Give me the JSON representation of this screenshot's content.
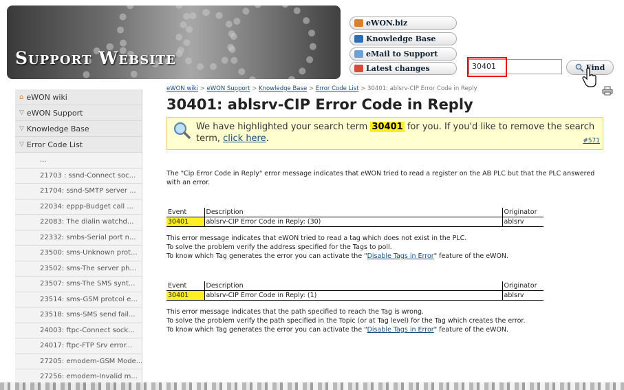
{
  "header": {
    "banner_title": "Support Website",
    "links": [
      {
        "label": "eWON.biz",
        "icon": "home-icon",
        "color": "#d9822b"
      },
      {
        "label": "Knowledge Base",
        "icon": "book-icon",
        "color": "#2d6fb7"
      },
      {
        "label": "eMail to Support",
        "icon": "mail-icon",
        "color": "#6ea0d8"
      },
      {
        "label": "Latest changes",
        "icon": "calendar-icon",
        "color": "#d84a3a"
      }
    ],
    "search_value": "30401",
    "find_label": "Find"
  },
  "sidebar": {
    "top_items": [
      {
        "label": "eWON wiki",
        "icon": "home-icon"
      },
      {
        "label": "eWON Support",
        "icon": "expand-icon"
      },
      {
        "label": "Knowledge Base",
        "icon": "expand-icon"
      },
      {
        "label": "Error Code List",
        "icon": "expand-icon"
      }
    ],
    "sub_items": [
      "...",
      "21703 : ssnd-Connect soc...",
      "21704: ssnd-SMTP server ...",
      "22034: eppp-Budget call ...",
      "22083: The dialin watchd...",
      "22332: smbs-Serial port n...",
      "23500: sms-Unknown prot...",
      "23502: sms-The server ph...",
      "23507: sms-The SMS synt...",
      "23514: sms-GSM protcol e...",
      "23518: sms-SMS send fail...",
      "24003: ftpc-Connect sock...",
      "24017: ftpc-FTP Srv error...",
      "27205: emodem-GSM Mode...",
      "27256: emodem-Invalid m..."
    ]
  },
  "breadcrumb": {
    "items": [
      "eWON wiki",
      "eWON Support",
      "Knowledge Base",
      "Error Code List"
    ],
    "sep": " > ",
    "current": "30401: ablsrv-CIP Error Code in Reply"
  },
  "page_title": "30401: ablsrv-CIP Error Code in Reply",
  "notice": {
    "before": "We have highlighted your search term ",
    "term": "30401",
    "after": " for you. If you'd like to remove the search term, ",
    "link": "click here",
    "end": ".",
    "ref": "#571"
  },
  "intro": "The \"Cip Error Code in Reply\" error message indicates that eWON tried to read a register on the AB PLC but that the PLC answered with an error.",
  "tables": [
    {
      "headers": [
        "Event",
        "Description",
        "Originator"
      ],
      "row": [
        "30401",
        "ablsrv-CIP Error Code in Reply: (30)",
        "ablsrv"
      ],
      "lines": [
        "This error message indicates that eWON tried to read a tag which does not exist in the PLC.",
        "To solve the problem verify the address specified for the Tags to poll."
      ],
      "know_before": "To know which Tag generates the error you can activate the \"",
      "know_link": "Disable Tags in Error",
      "know_after": "\" feature of the eWON."
    },
    {
      "headers": [
        "Event",
        "Description",
        "Originator"
      ],
      "row": [
        "30401",
        "ablsrv-CIP Error Code in Reply: (1)",
        "ablsrv"
      ],
      "lines": [
        "This error message indicates that the path specified to reach the Tag is wrong.",
        "To solve the problem verify the path specified in the Topic (or at Tag level) for the Tag which creates the error."
      ],
      "know_before": "To know which Tag generates the error you can activate the \"",
      "know_link": "Disable Tags in Error",
      "know_after": "\" feature of the eWON."
    }
  ]
}
